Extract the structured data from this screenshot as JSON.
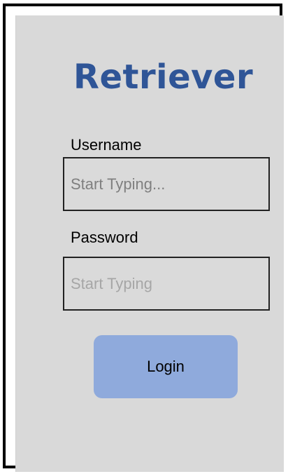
{
  "app": {
    "title": "Retriever"
  },
  "form": {
    "username_label": "Username",
    "username_placeholder": "Start Typing...",
    "username_value": "",
    "password_label": "Password",
    "password_placeholder": "Start Typing",
    "password_value": "",
    "login_label": "Login"
  },
  "colors": {
    "brand": "#2f5597",
    "background": "#d9d9d9",
    "button": "#8faadc"
  }
}
